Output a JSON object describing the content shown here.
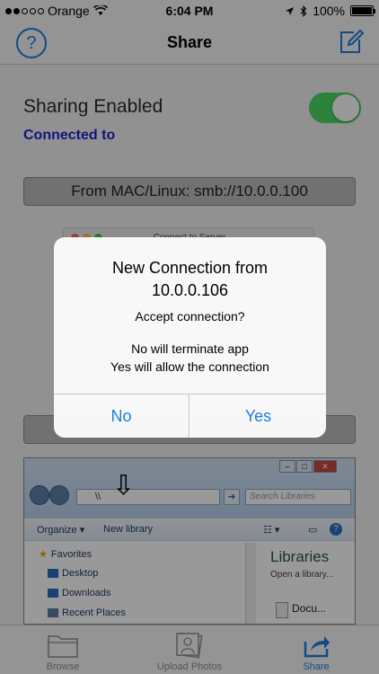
{
  "status_bar": {
    "carrier": "Orange",
    "time": "6:04 PM",
    "battery": "100%"
  },
  "nav": {
    "title": "Share",
    "help_label": "?"
  },
  "content": {
    "sharing_label": "Sharing Enabled",
    "connected_label": "Connected to",
    "sharing_enabled": true,
    "address": "From MAC/Linux:  smb://10.0.0.100",
    "connect_panel_title": "Connect to Server"
  },
  "explorer": {
    "address_text": "\\\\",
    "search_placeholder": "Search Libraries",
    "toolbar": [
      "Organize ▾",
      "New library"
    ],
    "tree": [
      "Favorites",
      "Desktop",
      "Downloads",
      "Recent Places"
    ],
    "libraries_title": "Libraries",
    "libraries_sub": "Open a library...",
    "doc_label": "Docu..."
  },
  "alert": {
    "title_line1": "New Connection from",
    "title_line2": "10.0.0.106",
    "message": "Accept connection?",
    "detail_line1": "No will terminate app",
    "detail_line2": "Yes will allow the connection",
    "no_label": "No",
    "yes_label": "Yes"
  },
  "tabs": [
    {
      "label": "Browse",
      "icon": "folder-icon"
    },
    {
      "label": "Upload Photos",
      "icon": "photos-icon"
    },
    {
      "label": "Share",
      "icon": "share-icon"
    }
  ],
  "colors": {
    "accent": "#1a7fe0",
    "toggle_on": "#4cd964",
    "connected_text": "#1f1fd0"
  }
}
